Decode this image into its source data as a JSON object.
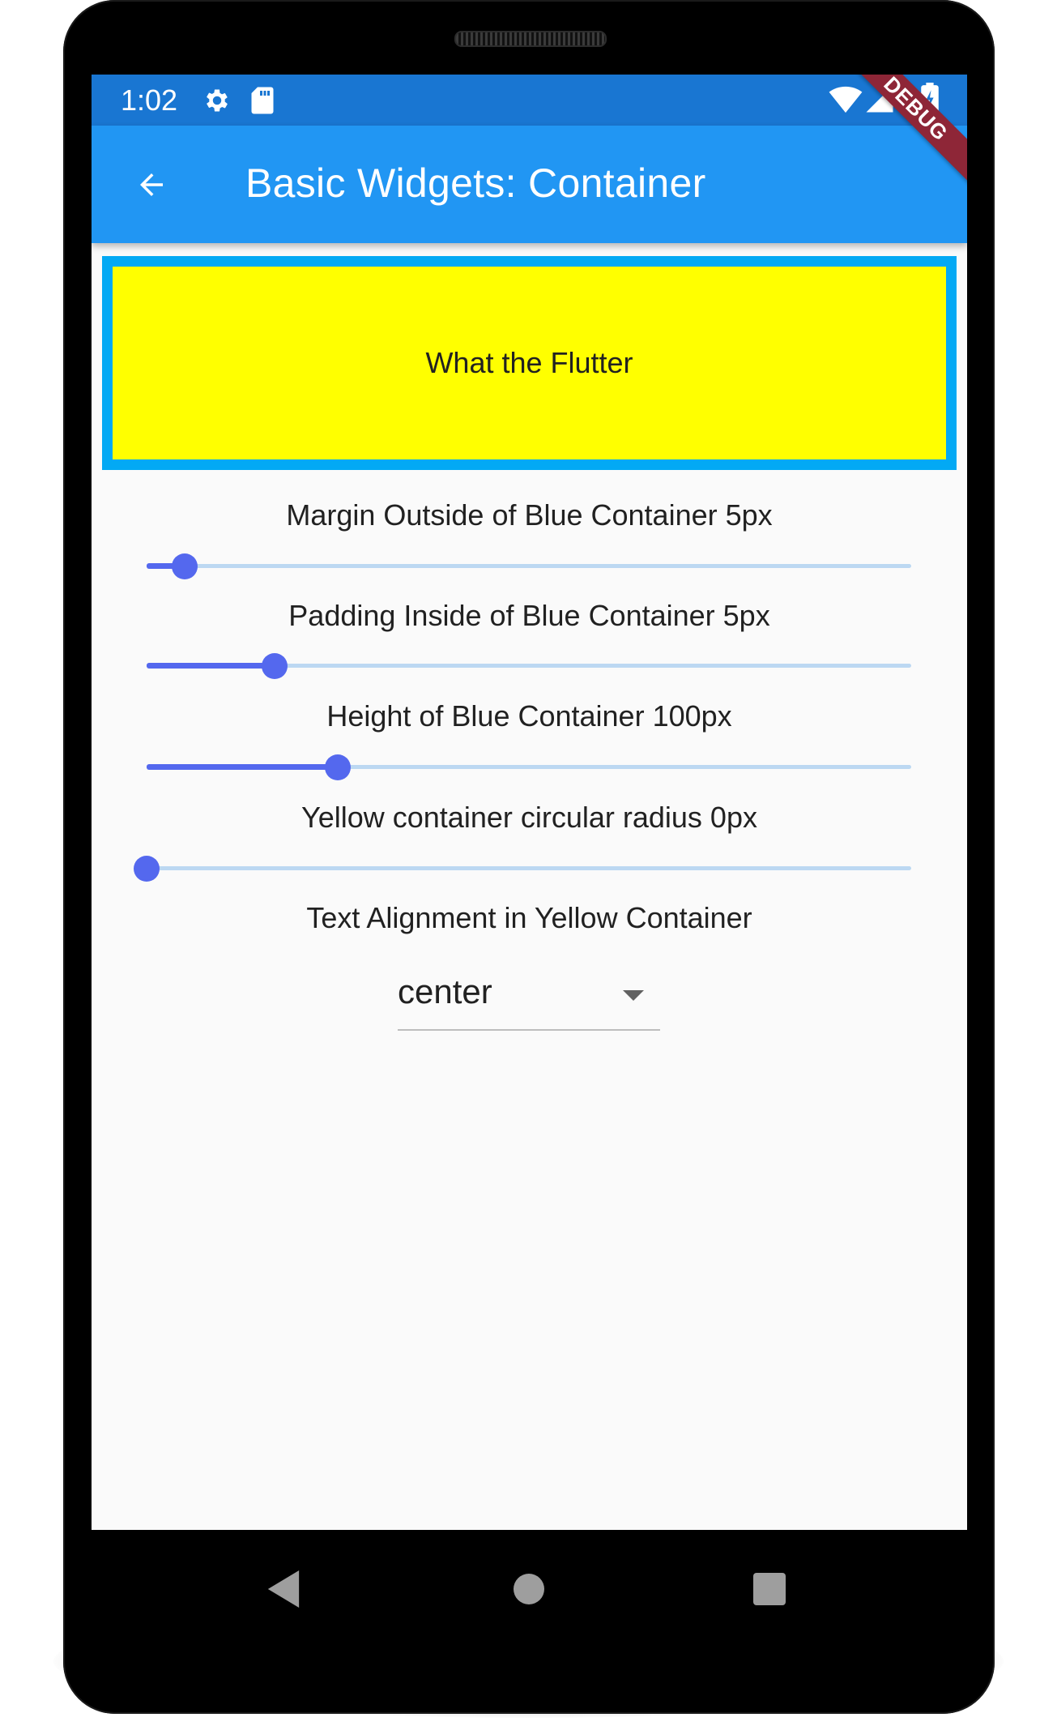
{
  "status_bar": {
    "time": "1:02",
    "icons": [
      "gear-icon",
      "sd-card-icon",
      "wifi-icon",
      "signal-icon",
      "battery-icon"
    ]
  },
  "app_bar": {
    "back_icon": "arrow-left-icon",
    "title": "Basic Widgets: Container",
    "debug_banner": "DEBUG"
  },
  "preview": {
    "text": "What the Flutter",
    "outer_color": "#03a9f4",
    "inner_color": "#ffff00"
  },
  "sliders": [
    {
      "label": "Margin Outside of Blue Container 5px",
      "value": 0.05
    },
    {
      "label": "Padding Inside of Blue Container 5px",
      "value": 0.167
    },
    {
      "label": "Height of Blue Container 100px",
      "value": 0.25
    },
    {
      "label": "Yellow container circular radius 0px",
      "value": 0.0
    }
  ],
  "text_alignment": {
    "label": "Text Alignment in Yellow Container",
    "selected": "center"
  },
  "navigation_bar": {
    "icons": [
      "back-triangle-icon",
      "home-circle-icon",
      "recents-square-icon"
    ]
  },
  "colors": {
    "status_bar": "#1976d2",
    "app_bar": "#2196f3",
    "slider_active": "#5468ee",
    "slider_inactive": "#bcd8f2",
    "debug_ribbon": "#8e2637"
  }
}
